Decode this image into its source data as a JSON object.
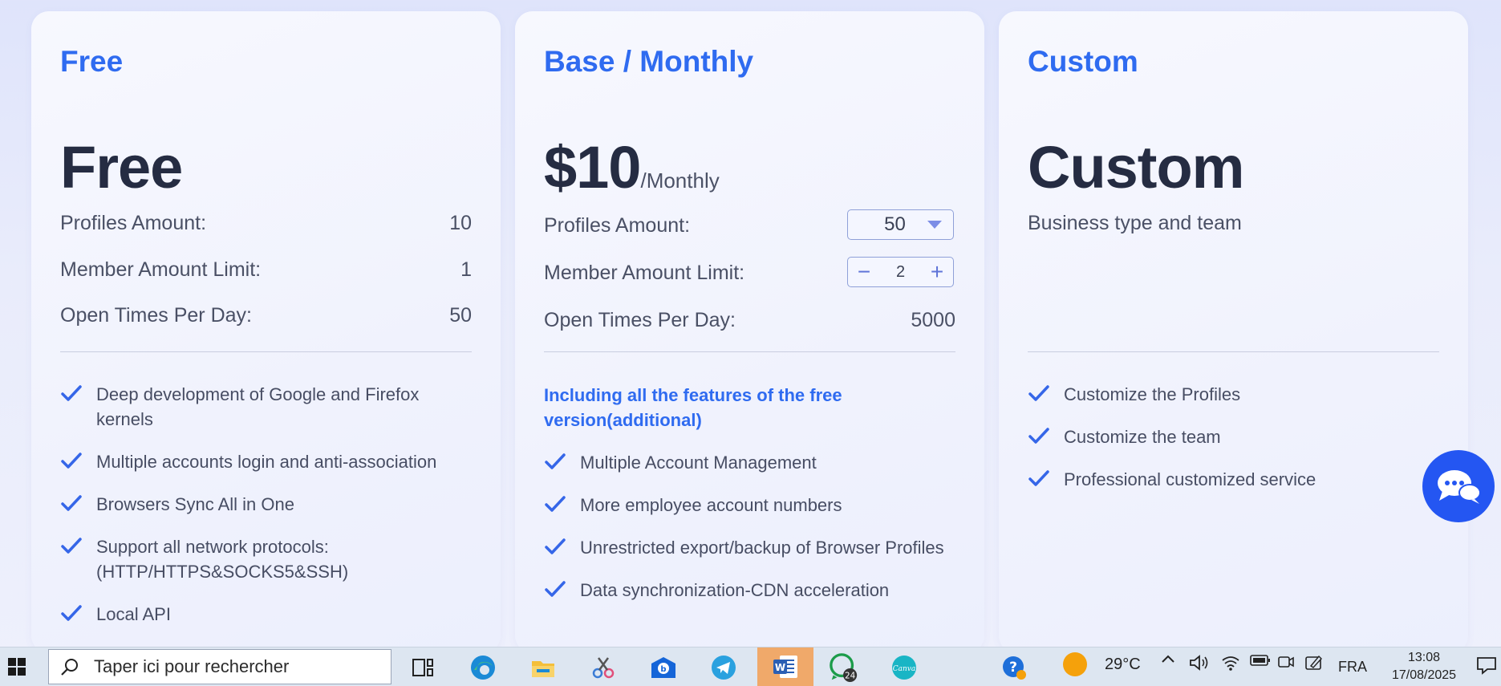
{
  "colors": {
    "accent": "#2f6bf0",
    "heading": "#252c42",
    "text": "#4a5065",
    "fab": "#2456f2"
  },
  "plans": {
    "free": {
      "name": "Free",
      "price": "Free",
      "rows": [
        {
          "label": "Profiles Amount:",
          "value": "10"
        },
        {
          "label": "Member Amount Limit:",
          "value": "1"
        },
        {
          "label": "Open Times Per Day:",
          "value": "50"
        }
      ],
      "features": [
        "Deep development of Google and Firefox kernels",
        "Multiple accounts login and anti-association",
        "Browsers Sync All in One",
        "Support all network protocols: (HTTP/HTTPS&SOCKS5&SSH)",
        "Local API"
      ]
    },
    "base": {
      "name": "Base / Monthly",
      "price": "$10",
      "price_unit": "/Monthly",
      "profiles_label": "Profiles Amount:",
      "profiles_value": "50",
      "member_label": "Member Amount Limit:",
      "member_value": "2",
      "open_label": "Open Times Per Day:",
      "open_value": "5000",
      "included_note": "Including all the features of the free version(additional)",
      "features": [
        "Multiple Account Management",
        "More employee account numbers",
        "Unrestricted export/backup of Browser Profiles",
        "Data synchronization-CDN acceleration"
      ]
    },
    "custom": {
      "name": "Custom",
      "price": "Custom",
      "subtitle": "Business type and team",
      "features": [
        "Customize the Profiles",
        "Customize the team",
        "Professional customized service"
      ]
    }
  },
  "chat": {
    "icon": "chat-bubbles-icon"
  },
  "taskbar": {
    "search_placeholder": "Taper ici pour rechercher",
    "weather_temp": "29°C",
    "language": "FRA",
    "time": "13:08",
    "date": "17/08/2025",
    "whatsapp_badge": "24",
    "apps": [
      "task-view-icon",
      "edge-icon",
      "file-explorer-icon",
      "snipping-icon",
      "mail-icon",
      "telegram-icon",
      "word-icon",
      "whatsapp-icon",
      "canva-icon",
      "help-icon"
    ]
  }
}
